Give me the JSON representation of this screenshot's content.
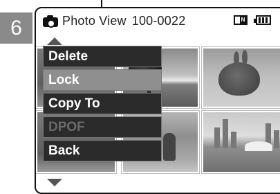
{
  "step_number": "6",
  "header": {
    "title": "Photo View",
    "file_number": "100-0022",
    "mode_badge": "N"
  },
  "menu": {
    "items": [
      {
        "label": "Delete",
        "state": "normal"
      },
      {
        "label": "Lock",
        "state": "selected"
      },
      {
        "label": "Copy To",
        "state": "normal"
      },
      {
        "label": "DPOF",
        "state": "disabled"
      },
      {
        "label": "Back",
        "state": "normal"
      }
    ]
  },
  "thumbnails": [
    {
      "subject": "partial-photo"
    },
    {
      "subject": "palm-beach"
    },
    {
      "subject": "rabbit"
    },
    {
      "subject": "partial-photo"
    },
    {
      "subject": "person-garden"
    },
    {
      "subject": "city-skyline"
    }
  ],
  "colors": {
    "menu_bg": "#2b2b2b",
    "menu_selected": "#8f8f8f",
    "menu_disabled_text": "#6a6a6a",
    "step_badge": "#8a8a8a"
  }
}
